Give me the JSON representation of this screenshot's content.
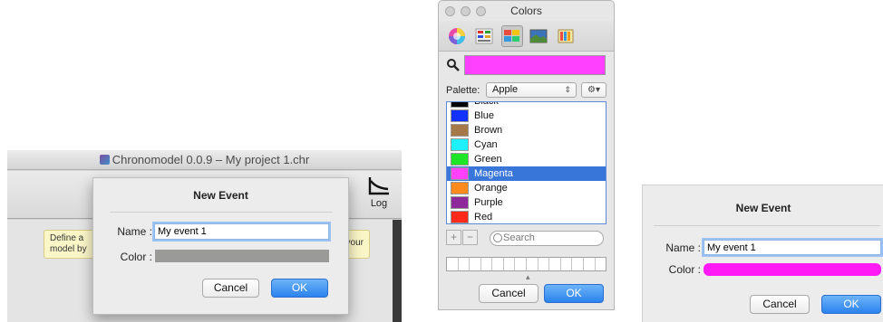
{
  "app_window": {
    "title": "Chronomodel 0.0.9 – My project 1.chr",
    "toolbar": {
      "log_label": "Log"
    },
    "hint_text_left": "Define a\nmodel by",
    "hint_text_right": "ing your"
  },
  "sheet_dialog": {
    "title": "New Event",
    "name_label": "Name :",
    "name_value": "My event 1",
    "color_label": "Color :",
    "color_value": "#9a9a98",
    "cancel_label": "Cancel",
    "ok_label": "OK"
  },
  "colors_panel": {
    "title": "Colors",
    "selected_color": "#ff40ff",
    "palette_label": "Palette:",
    "palette_value": "Apple",
    "search_placeholder": "Search",
    "colors": [
      {
        "name": "Black",
        "hex": "#000000"
      },
      {
        "name": "Blue",
        "hex": "#1432ff"
      },
      {
        "name": "Brown",
        "hex": "#a5794a"
      },
      {
        "name": "Cyan",
        "hex": "#1ef0ff"
      },
      {
        "name": "Green",
        "hex": "#1ee627"
      },
      {
        "name": "Magenta",
        "hex": "#ff40ff"
      },
      {
        "name": "Orange",
        "hex": "#ff8a1e"
      },
      {
        "name": "Purple",
        "hex": "#8e2a9a"
      },
      {
        "name": "Red",
        "hex": "#ff2a1a"
      }
    ],
    "selected_name": "Magenta",
    "cancel_label": "Cancel",
    "ok_label": "OK"
  },
  "standalone_dialog": {
    "title": "New Event",
    "name_label": "Name :",
    "name_value": "My event 1",
    "color_label": "Color :",
    "color_value": "#ff1af5",
    "cancel_label": "Cancel",
    "ok_label": "OK"
  }
}
